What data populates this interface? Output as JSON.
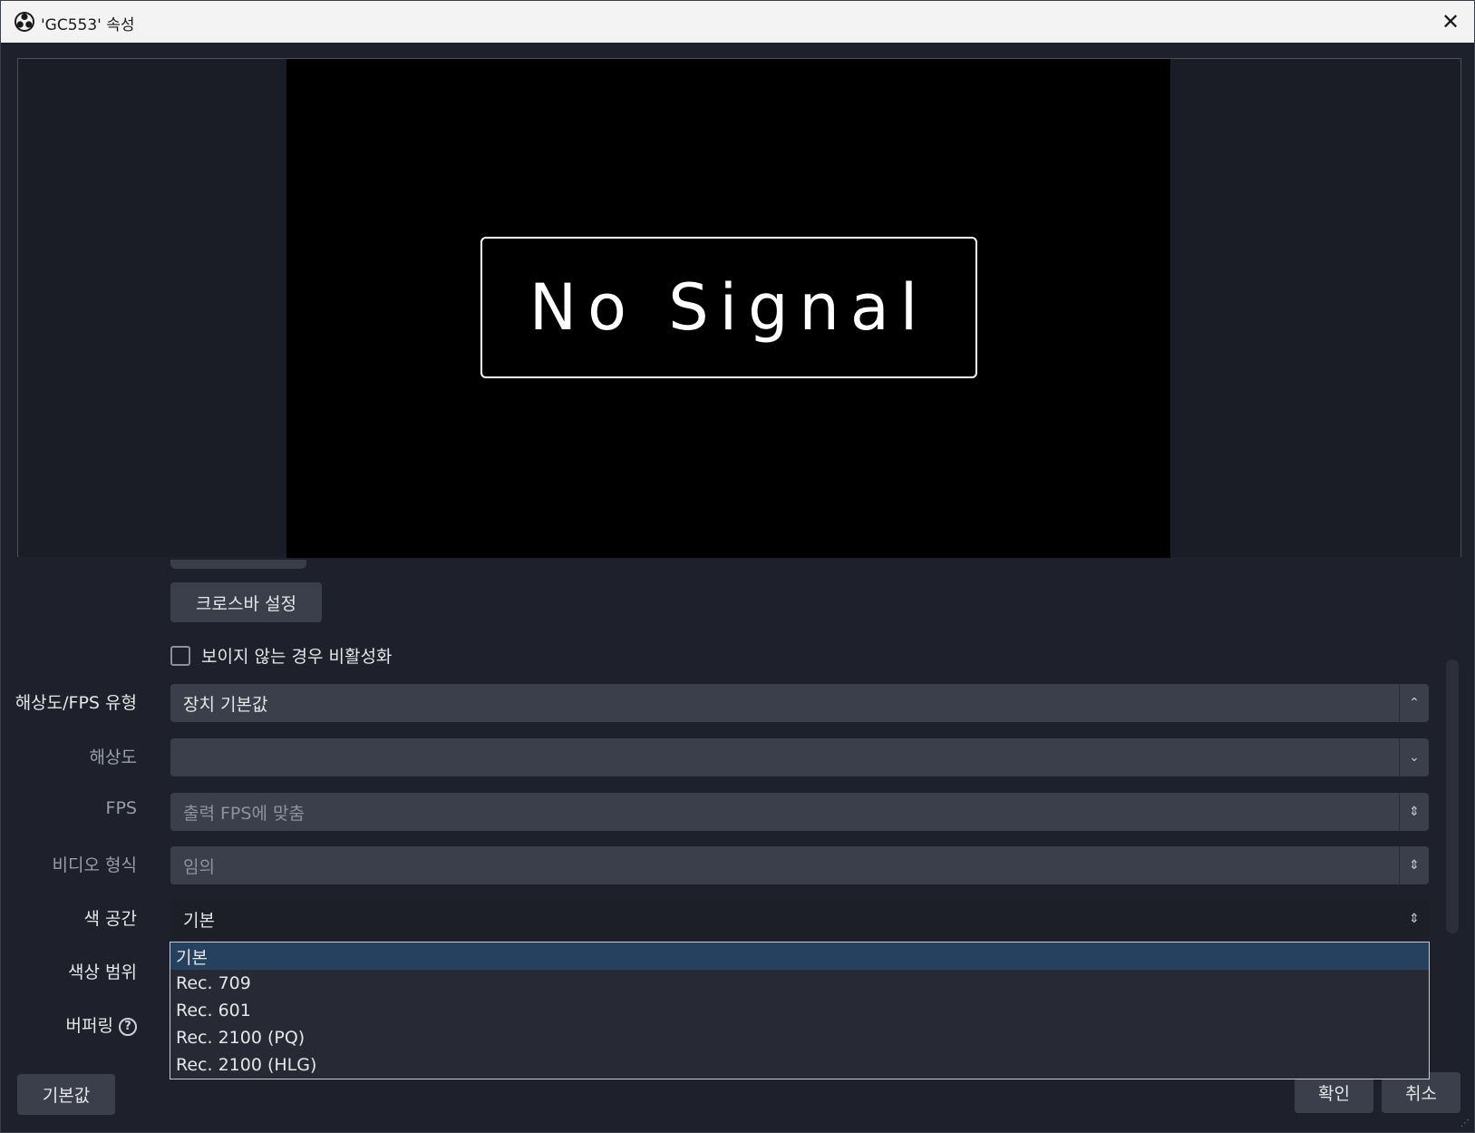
{
  "window": {
    "title": "'GC553' 속성",
    "close_symbol": "✕"
  },
  "preview": {
    "message": "No Signal"
  },
  "properties": {
    "crossbar_button": "크로스바 설정",
    "deactivate_checkbox": {
      "label": "보이지 않는 경우 비활성화",
      "checked": false
    },
    "rows": {
      "resolution_fps_type": {
        "label": "해상도/FPS 유형",
        "value": "장치 기본값"
      },
      "resolution": {
        "label": "해상도",
        "value": ""
      },
      "fps": {
        "label": "FPS",
        "value": "출력 FPS에 맞춤"
      },
      "video_format": {
        "label": "비디오 형식",
        "value": "임의"
      },
      "color_space": {
        "label": "색 공간",
        "value": "기본"
      },
      "color_range": {
        "label": "색상 범위"
      },
      "buffering": {
        "label": "버퍼링",
        "help_symbol": "?"
      }
    },
    "color_space_options": [
      "기본",
      "Rec. 709",
      "Rec. 601",
      "Rec. 2100 (PQ)",
      "Rec. 2100 (HLG)"
    ],
    "color_space_selected": "기본"
  },
  "footer": {
    "defaults_button": "기본값",
    "ok_button": "확인",
    "cancel_button": "취소"
  },
  "colors": {
    "background": "#1e212b",
    "control": "#3b3f4c",
    "selection": "#26405f"
  }
}
